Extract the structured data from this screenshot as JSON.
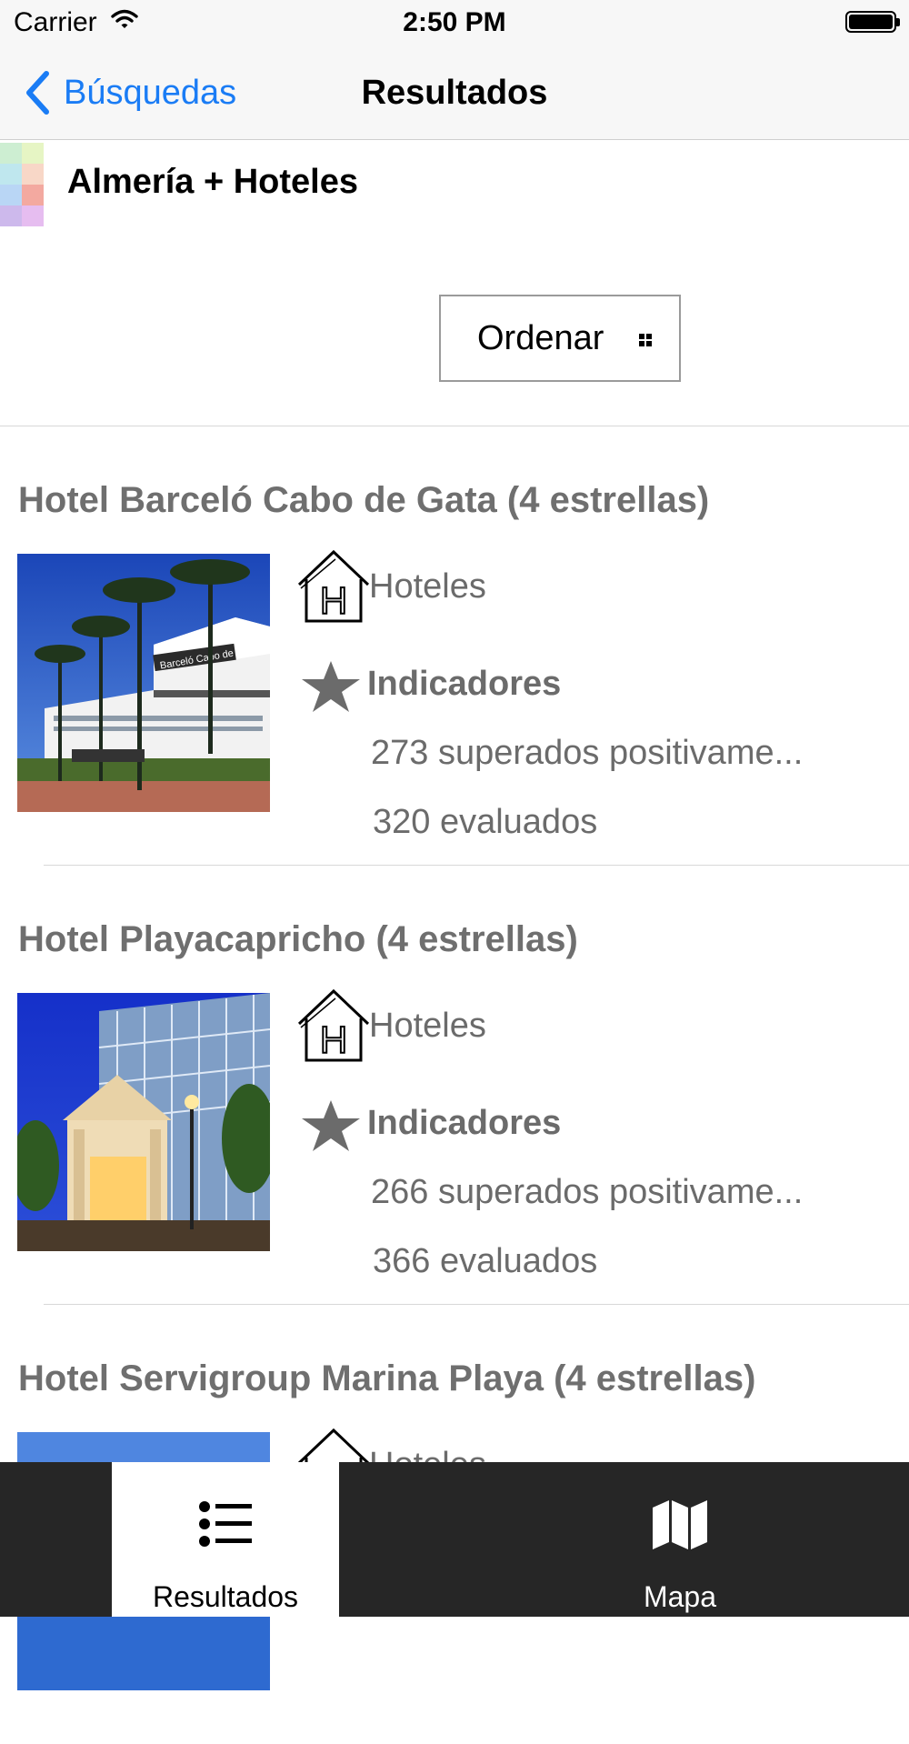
{
  "status_bar": {
    "carrier": "Carrier",
    "time": "2:50 PM"
  },
  "nav": {
    "back_label": "Búsquedas",
    "title": "Resultados"
  },
  "search": {
    "title": "Almería + Hoteles"
  },
  "sort": {
    "label": "Ordenar"
  },
  "results": [
    {
      "title": "Hotel Barceló Cabo de Gata (4 estrellas)",
      "category": "Hoteles",
      "indicators_label": "Indicadores",
      "passed": "273 superados positivame...",
      "evaluated": "320 evaluados",
      "image_sign": "Barceló Cabo de Gata"
    },
    {
      "title": "Hotel Playacapricho (4 estrellas)",
      "category": "Hoteles",
      "indicators_label": "Indicadores",
      "passed": "266 superados positivame...",
      "evaluated": "366 evaluados"
    },
    {
      "title": "Hotel Servigroup Marina Playa (4 estrellas)",
      "category": "Hoteles"
    }
  ],
  "tabs": [
    {
      "label": "Resultados",
      "icon": "list-icon",
      "selected": true
    },
    {
      "label": "Mapa",
      "icon": "map-icon",
      "selected": false
    }
  ],
  "colors": {
    "accent": "#1a7cf5",
    "tabbar": "#262626",
    "text_gray": "#6b6b6b"
  }
}
